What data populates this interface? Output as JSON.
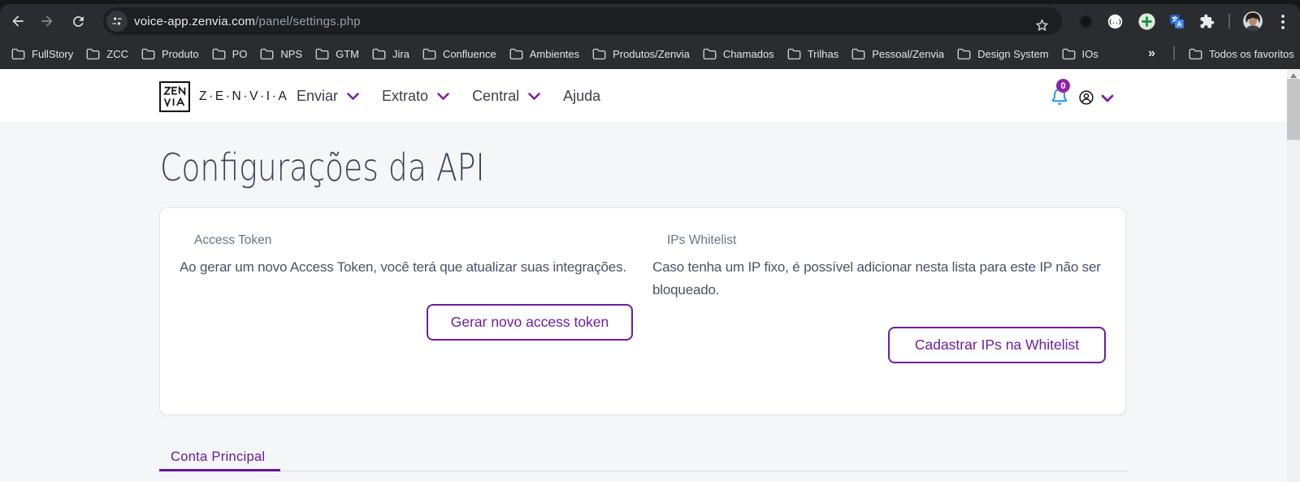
{
  "browser": {
    "url": {
      "host": "voice-app.zenvia.com",
      "path": "/panel/settings.php"
    },
    "bookmarks": [
      "FullStory",
      "ZCC",
      "Produto",
      "PO",
      "NPS",
      "GTM",
      "Jira",
      "Confluence",
      "Ambientes",
      "Produtos/Zenvia",
      "Chamados",
      "Trilhas",
      "Pessoal/Zenvia",
      "Design System",
      "IOs"
    ],
    "bookmarks_overflow": "»",
    "all_bookmarks_label": "Todos os favoritos"
  },
  "header": {
    "logo_line1": "ZEN",
    "logo_line2": "VIA",
    "brand": "Z·E·N·V·I·A",
    "nav": [
      {
        "label": "Enviar"
      },
      {
        "label": "Extrato"
      },
      {
        "label": "Central"
      },
      {
        "label": "Ajuda"
      }
    ],
    "notifications_count": "0"
  },
  "main": {
    "page_title": "Configurações da API",
    "sections": [
      {
        "label": "Access Token",
        "description": "Ao gerar um novo Access Token, você terá que atualizar suas integrações.",
        "button": "Gerar novo access token"
      },
      {
        "label": "IPs Whitelist",
        "description": "Caso tenha um IP fixo, é possível adicionar nesta lista para este IP não ser bloqueado.",
        "button": "Cadastrar IPs na Whitelist"
      }
    ],
    "tabs": [
      {
        "label": "Conta Principal"
      }
    ]
  },
  "colors": {
    "accent_purple": "#6d1f9e",
    "bell_blue": "#2196f3",
    "badge_purple": "#8e24aa",
    "chrome_dark": "#2b2c2f",
    "page_background": "#f5f6f8"
  }
}
